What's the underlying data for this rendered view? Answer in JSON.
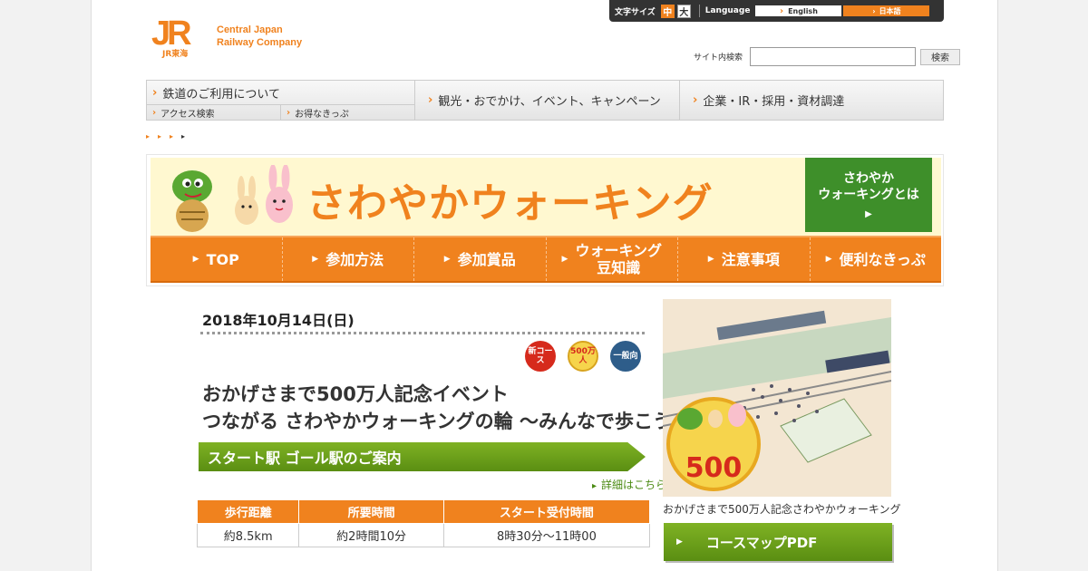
{
  "header": {
    "logo_mark": "JR",
    "logo_sub": "JR東海",
    "logo_line1": "Central Japan",
    "logo_line2": "Railway Company"
  },
  "util": {
    "font_size_label": "文字サイズ",
    "font_mid": "中",
    "font_big": "大",
    "language_label": "Language",
    "lang_en": "English",
    "lang_ja": "日本語"
  },
  "search": {
    "label": "サイト内検索",
    "button": "検索",
    "value": ""
  },
  "gnav": {
    "item1": "鉄道のご利用について",
    "sub1": "アクセス検索",
    "sub2": "お得なきっぷ",
    "item2": "観光・おでかけ、イベント、キャンペーン",
    "item3": "企業・IR・採用・資材調達"
  },
  "breadcrumbs": [
    "",
    "",
    "",
    ""
  ],
  "banner": {
    "title": "さわやかウォーキング",
    "about_line1": "さわやか",
    "about_line2": "ウォーキングとは"
  },
  "orange_nav": {
    "top": "TOP",
    "how": "参加方法",
    "prize": "参加賞品",
    "trivia_line1": "ウォーキング",
    "trivia_line2": "豆知識",
    "notes": "注意事項",
    "tickets": "便利なきっぷ"
  },
  "event": {
    "date": "2018年10月14日(日)",
    "badge_new": "新コース",
    "badge_500": "500万人",
    "badge_general": "一般向",
    "title_line1": "おかげさまで500万人記念イベント",
    "title_line2": "つながる さわやかウォーキングの輪 ～みんなで歩こう～",
    "station_bar": "スタート駅 ゴール駅のご案内",
    "detail_link": "詳細はこちら",
    "table_headers": [
      "歩行距離",
      "所要時間",
      "スタート受付時間"
    ],
    "table_values": [
      "約8.5km",
      "約2時間10分",
      "8時30分～11時00"
    ]
  },
  "sidebar": {
    "poster_caption": "おかげさまで500万人記念さわやかウォーキング",
    "map_button": "コースマップPDF"
  },
  "colors": {
    "brand_orange": "#f0821e",
    "brand_green": "#5a8e12"
  }
}
